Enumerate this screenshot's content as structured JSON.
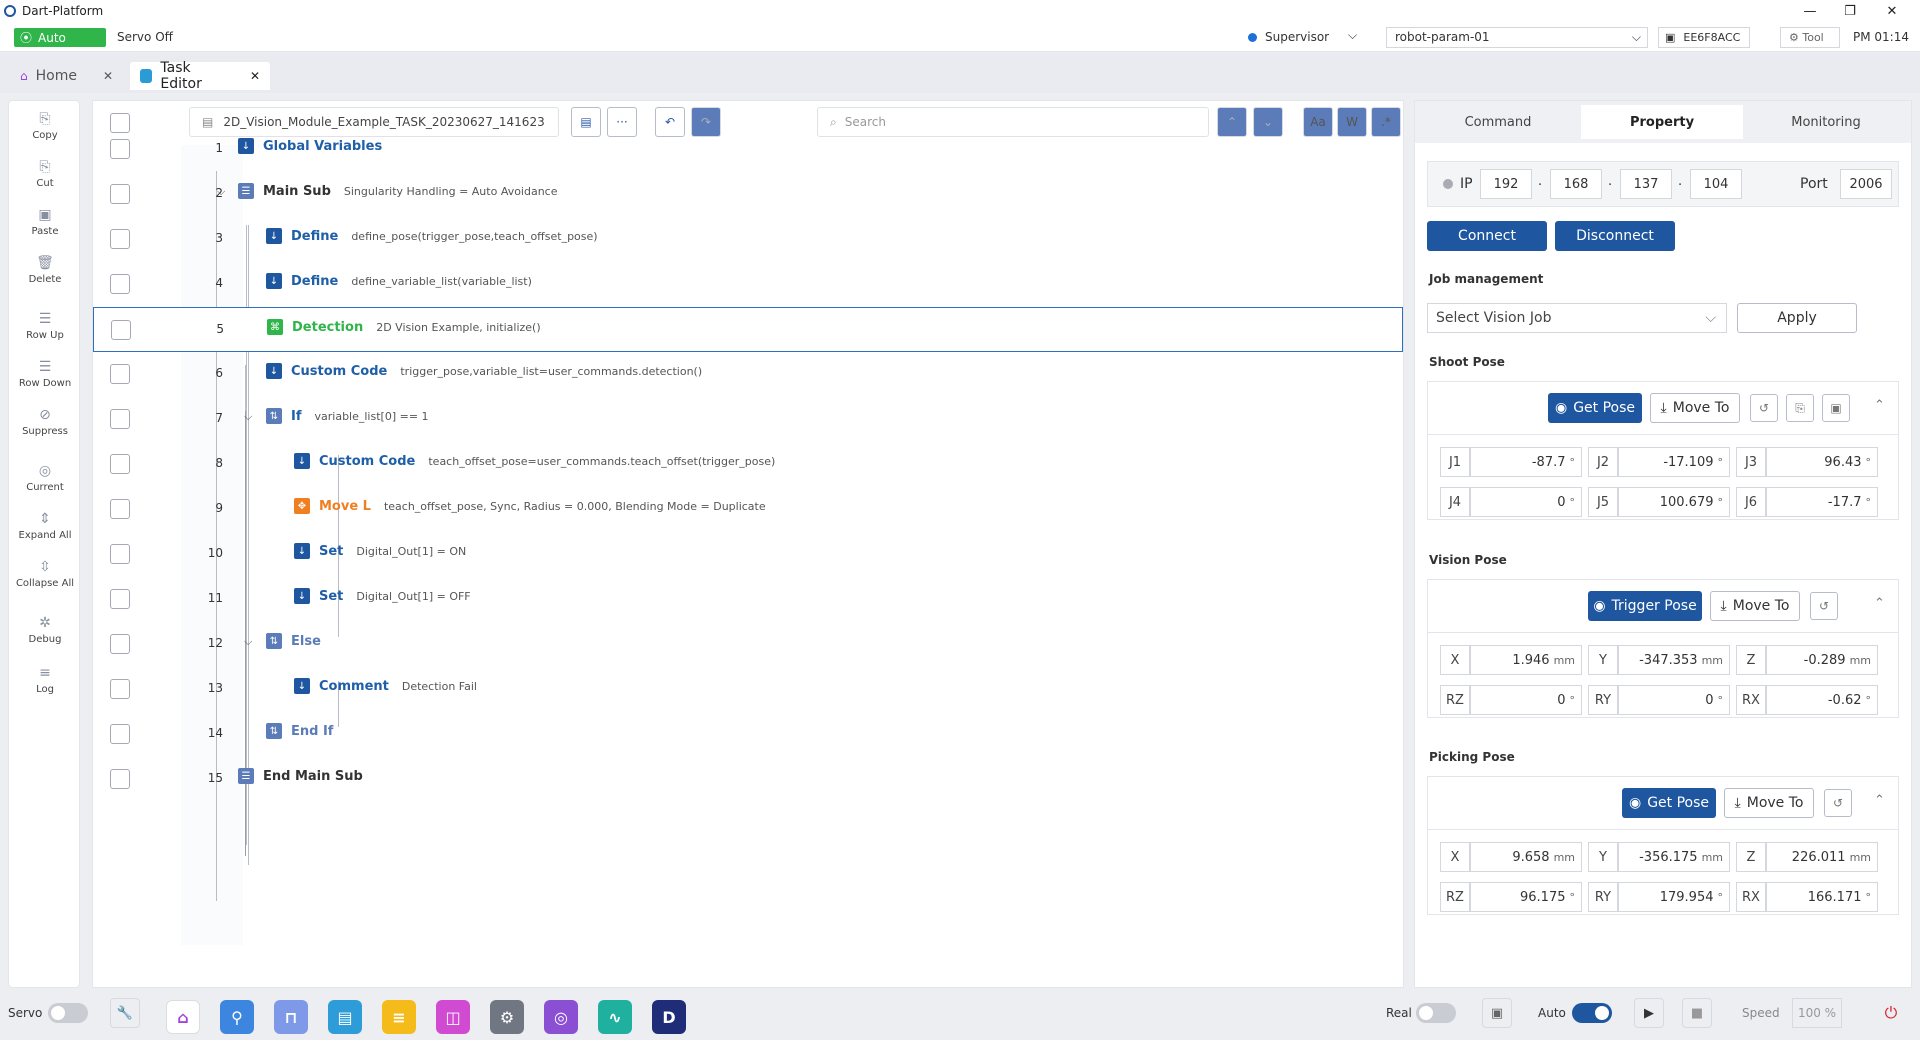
{
  "window": {
    "title": "Dart-Platform"
  },
  "status": {
    "mode": "Auto",
    "servo_state": "Servo Off",
    "user": "Supervisor",
    "param": "robot-param-01",
    "device_id": "EE6F8ACC",
    "tool": "Tool",
    "time": "PM 01:14"
  },
  "tabs": [
    {
      "label": "Home"
    },
    {
      "label": "Task Editor"
    }
  ],
  "toolbar": {
    "file_name": "2D_Vision_Module_Example_TASK_20230627_141623",
    "search_placeholder": "Search",
    "more": "···",
    "case_btn": "Aa",
    "word_btn": "W",
    "regex_btn": ".*"
  },
  "leftbar": [
    "Copy",
    "Cut",
    "Paste",
    "Delete",
    "Row Up",
    "Row Down",
    "Suppress",
    "Current",
    "Expand All",
    "Collapse All",
    "Debug",
    "Log"
  ],
  "rows": [
    {
      "num": "1",
      "kw": "Global Variables",
      "arg": ""
    },
    {
      "num": "2",
      "kw": "Main Sub",
      "arg": "Singularity Handling = Auto Avoidance"
    },
    {
      "num": "3",
      "kw": "Define",
      "arg": "define_pose(trigger_pose,teach_offset_pose)"
    },
    {
      "num": "4",
      "kw": "Define",
      "arg": "define_variable_list(variable_list)"
    },
    {
      "num": "5",
      "kw": "Detection",
      "arg": "2D Vision Example, initialize()"
    },
    {
      "num": "6",
      "kw": "Custom Code",
      "arg": "trigger_pose,variable_list=user_commands.detection()"
    },
    {
      "num": "7",
      "kw": "If",
      "arg": "variable_list[0] == 1"
    },
    {
      "num": "8",
      "kw": "Custom Code",
      "arg": "teach_offset_pose=user_commands.teach_offset(trigger_pose)"
    },
    {
      "num": "9",
      "kw": "Move L",
      "arg": "teach_offset_pose, Sync, Radius = 0.000, Blending Mode = Duplicate"
    },
    {
      "num": "10",
      "kw": "Set",
      "arg": "Digital_Out[1] = ON"
    },
    {
      "num": "11",
      "kw": "Set",
      "arg": "Digital_Out[1] = OFF"
    },
    {
      "num": "12",
      "kw": "Else",
      "arg": ""
    },
    {
      "num": "13",
      "kw": "Comment",
      "arg": "Detection Fail"
    },
    {
      "num": "14",
      "kw": "End If",
      "arg": ""
    },
    {
      "num": "15",
      "kw": "End Main Sub",
      "arg": ""
    }
  ],
  "right": {
    "tabs": [
      "Command",
      "Property",
      "Monitoring"
    ],
    "ip_label": "IP",
    "ip": [
      "192",
      "168",
      "137",
      "104"
    ],
    "port_label": "Port",
    "port": "2006",
    "connect": "Connect",
    "disconnect": "Disconnect",
    "job_label": "Job management",
    "job_placeholder": "Select Vision Job",
    "apply": "Apply",
    "shoot": {
      "title": "Shoot Pose",
      "btn": "Get Pose",
      "move": "Move To",
      "fields": [
        [
          "J1",
          "-87.7",
          "°"
        ],
        [
          "J2",
          "-17.109",
          "°"
        ],
        [
          "J3",
          "96.43",
          "°"
        ],
        [
          "J4",
          "0",
          "°"
        ],
        [
          "J5",
          "100.679",
          "°"
        ],
        [
          "J6",
          "-17.7",
          "°"
        ]
      ]
    },
    "vision": {
      "title": "Vision Pose",
      "btn": "Trigger Pose",
      "move": "Move To",
      "fields": [
        [
          "X",
          "1.946",
          "mm"
        ],
        [
          "Y",
          "-347.353",
          "mm"
        ],
        [
          "Z",
          "-0.289",
          "mm"
        ],
        [
          "RZ",
          "0",
          "°"
        ],
        [
          "RY",
          "0",
          "°"
        ],
        [
          "RX",
          "-0.62",
          "°"
        ]
      ]
    },
    "picking": {
      "title": "Picking Pose",
      "btn": "Get Pose",
      "move": "Move To",
      "fields": [
        [
          "X",
          "9.658",
          "mm"
        ],
        [
          "Y",
          "-356.175",
          "mm"
        ],
        [
          "Z",
          "226.011",
          "mm"
        ],
        [
          "RZ",
          "96.175",
          "°"
        ],
        [
          "RY",
          "179.954",
          "°"
        ],
        [
          "RX",
          "166.171",
          "°"
        ]
      ]
    }
  },
  "dock": {
    "servo": "Servo",
    "real": "Real",
    "auto": "Auto",
    "speed_label": "Speed",
    "speed": "100 %"
  },
  "colors": {
    "primary": "#1e56a0",
    "auto_green": "#2fb54a",
    "move_orange": "#f07f22"
  }
}
